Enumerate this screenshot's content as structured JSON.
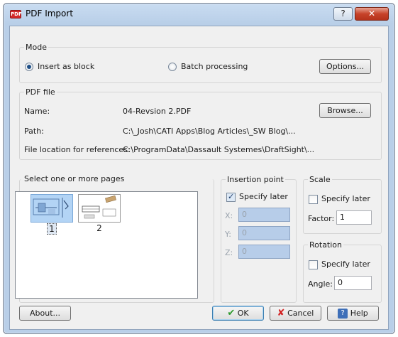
{
  "window": {
    "title": "PDF Import",
    "help_glyph": "?",
    "close_glyph": "✕"
  },
  "mode": {
    "title": "Mode",
    "insert_as_block": "Insert as block",
    "batch_processing": "Batch processing",
    "options_button": "Options..."
  },
  "pdf_file": {
    "title": "PDF file",
    "name_label": "Name:",
    "name_value": "04-Revsion 2.PDF",
    "path_label": "Path:",
    "path_value": "C:\\_Josh\\CATI Apps\\Blog Articles\\_SW Blog\\...",
    "fileloc_label": "File location for references:",
    "fileloc_value": "C:\\ProgramData\\Dassault Systemes\\DraftSight\\...",
    "browse_button": "Browse..."
  },
  "pages": {
    "title": "Select one or more pages",
    "items": [
      {
        "label": "1"
      },
      {
        "label": "2"
      }
    ]
  },
  "insertion": {
    "title": "Insertion point",
    "specify_later": "Specify later",
    "x_label": "X:",
    "x_value": "0",
    "y_label": "Y:",
    "y_value": "0",
    "z_label": "Z:",
    "z_value": "0"
  },
  "scale": {
    "title": "Scale",
    "specify_later": "Specify later",
    "factor_label": "Factor:",
    "factor_value": "1"
  },
  "rotation": {
    "title": "Rotation",
    "specify_later": "Specify later",
    "angle_label": "Angle:",
    "angle_value": "0"
  },
  "footer": {
    "about_button": "About...",
    "ok_button": "OK",
    "cancel_button": "Cancel",
    "help_button": "Help"
  },
  "icons": {
    "pdf": "pdf-icon",
    "ok": "check-icon",
    "cancel": "x-icon",
    "help": "question-icon"
  },
  "colors": {
    "selected_page": "#b3d4f5",
    "disabled_field": "#b7cde9"
  }
}
